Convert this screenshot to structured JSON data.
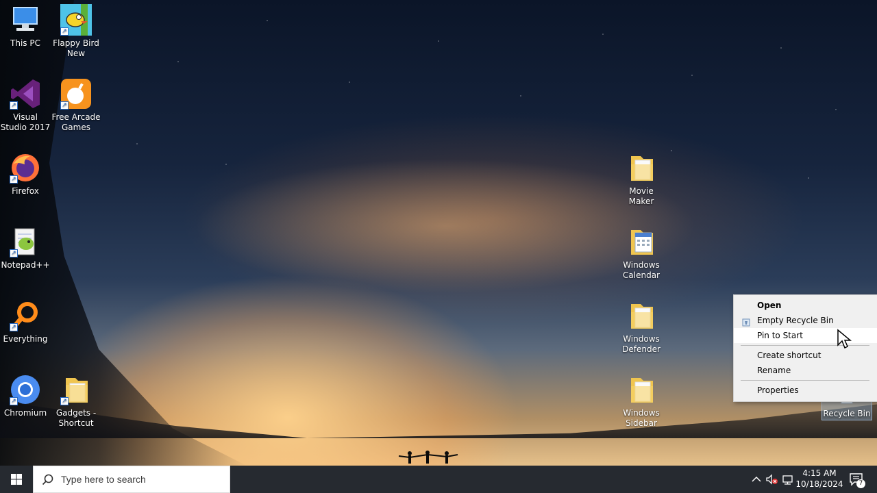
{
  "desktop": {
    "icons": [
      {
        "label": "This PC",
        "icon": "this-pc-icon"
      },
      {
        "label": "Flappy Bird New",
        "icon": "flappy-bird-icon"
      },
      {
        "label": "Visual Studio 2017",
        "icon": "visual-studio-icon"
      },
      {
        "label": "Free Arcade Games",
        "icon": "arcade-games-icon"
      },
      {
        "label": "Firefox",
        "icon": "firefox-icon"
      },
      {
        "label": "Notepad++",
        "icon": "notepad-plus-plus-icon"
      },
      {
        "label": "Everything",
        "icon": "everything-search-icon"
      },
      {
        "label": "Chromium",
        "icon": "chromium-icon"
      },
      {
        "label": "Gadgets - Shortcut",
        "icon": "folder-icon"
      },
      {
        "label": "Movie Maker",
        "icon": "folder-icon"
      },
      {
        "label": "Windows Calendar",
        "icon": "folder-calendar-icon"
      },
      {
        "label": "Windows Defender",
        "icon": "folder-icon"
      },
      {
        "label": "Windows Sidebar",
        "icon": "folder-icon"
      },
      {
        "label": "Recycle Bin",
        "icon": "recycle-bin-icon"
      }
    ]
  },
  "context_menu": {
    "items": [
      {
        "label": "Open",
        "bold": true
      },
      {
        "label": "Empty Recycle Bin",
        "icon": "recycle-bin-small-icon"
      },
      {
        "label": "Pin to Start",
        "hovered": true
      },
      {
        "label": "Create shortcut"
      },
      {
        "label": "Rename"
      },
      {
        "label": "Properties"
      }
    ]
  },
  "taskbar": {
    "search_placeholder": "Type here to search",
    "time": "4:15 AM",
    "date": "10/18/2024",
    "notification_count": "7"
  },
  "colors": {
    "taskbar": "#14181e",
    "menu_bg": "#f0f0f0",
    "menu_hover": "#ffffff",
    "accent_blue": "#2a6cc7"
  }
}
